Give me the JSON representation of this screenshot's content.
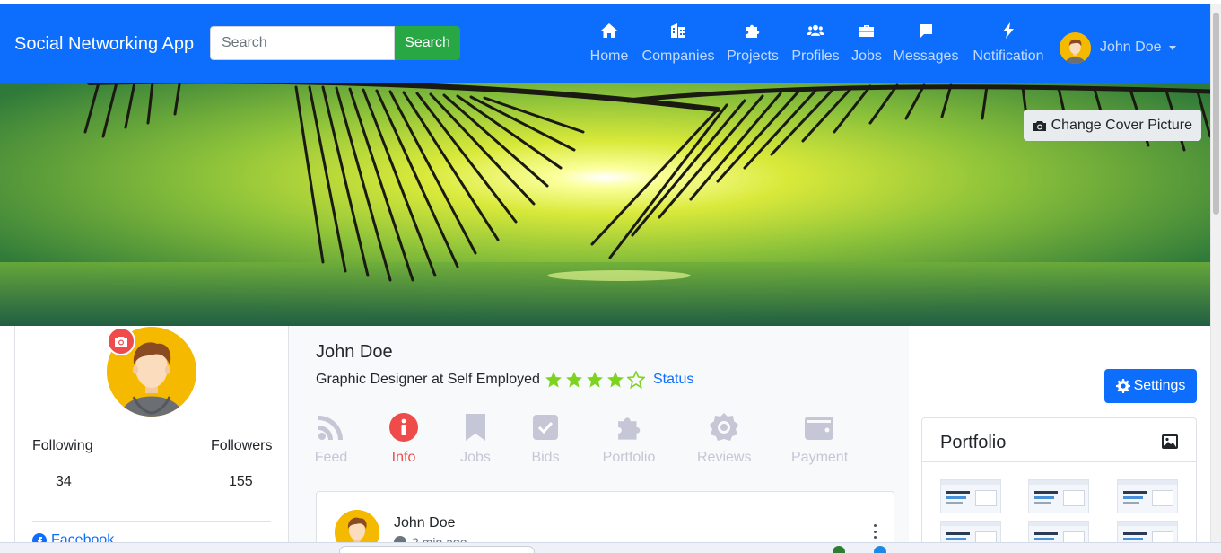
{
  "navbar": {
    "brand": "Social Networking App",
    "search_placeholder": "Search",
    "search_button": "Search",
    "items": [
      {
        "label": "Home",
        "icon": "home-icon"
      },
      {
        "label": "Companies",
        "icon": "building-icon"
      },
      {
        "label": "Projects",
        "icon": "puzzle-icon"
      },
      {
        "label": "Profiles",
        "icon": "users-icon"
      },
      {
        "label": "Jobs",
        "icon": "briefcase-icon"
      },
      {
        "label": "Messages",
        "icon": "message-icon"
      },
      {
        "label": "Notification",
        "icon": "bolt-icon"
      }
    ],
    "user_name": "John Doe"
  },
  "cover": {
    "change_button": "Change Cover Picture"
  },
  "profile": {
    "following_label": "Following",
    "followers_label": "Followers",
    "following_count": "34",
    "followers_count": "155",
    "facebook_label": "Facebook"
  },
  "main": {
    "name": "John Doe",
    "headline": "Graphic Designer at Self Employed",
    "rating": 4,
    "rating_max": 5,
    "status_link": "Status",
    "tabs": [
      {
        "label": "Feed",
        "icon": "rss-icon",
        "active": false
      },
      {
        "label": "Info",
        "icon": "info-icon",
        "active": true
      },
      {
        "label": "Jobs",
        "icon": "bookmark-icon",
        "active": false
      },
      {
        "label": "Bids",
        "icon": "checkbox-icon",
        "active": false
      },
      {
        "label": "Portfolio",
        "icon": "puzzle-icon",
        "active": false
      },
      {
        "label": "Reviews",
        "icon": "badge-icon",
        "active": false
      },
      {
        "label": "Payment",
        "icon": "wallet-icon",
        "active": false
      }
    ],
    "post": {
      "author": "John Doe",
      "time": "2 min ago"
    }
  },
  "sidebar_right": {
    "settings_button": "Settings",
    "portfolio_title": "Portfolio"
  },
  "colors": {
    "primary": "#0d6efd",
    "success": "#28a745",
    "accent_red": "#ef4b4b",
    "star_green": "#7ed321",
    "tab_inactive": "#c5c6d6"
  }
}
